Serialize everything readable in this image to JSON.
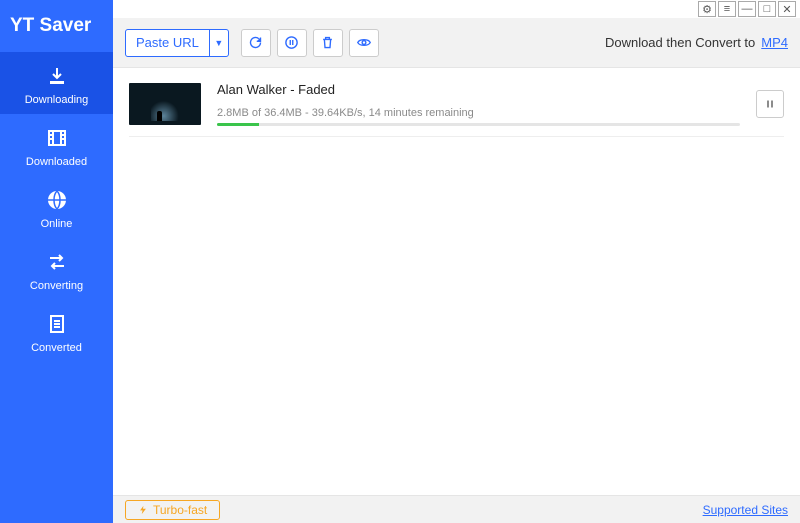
{
  "app_name": "YT Saver",
  "sidebar": {
    "items": [
      {
        "label": "Downloading"
      },
      {
        "label": "Downloaded"
      },
      {
        "label": "Online"
      },
      {
        "label": "Converting"
      },
      {
        "label": "Converted"
      }
    ]
  },
  "toolbar": {
    "paste_label": "Paste URL",
    "convert_prefix": "Download then Convert to",
    "format": "MP4"
  },
  "download": {
    "title": "Alan Walker - Faded",
    "status": "2.8MB of 36.4MB - 39.64KB/s, 14 minutes remaining",
    "progress_percent": 8
  },
  "footer": {
    "turbo_label": "Turbo-fast",
    "supported_label": "Supported Sites"
  }
}
